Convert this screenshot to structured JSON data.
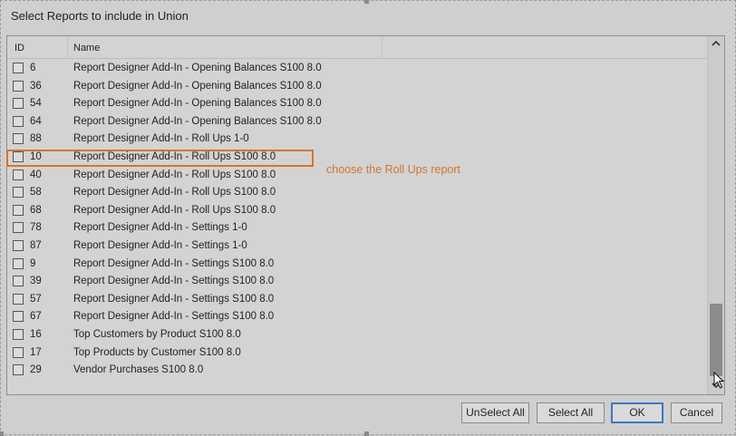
{
  "dialog": {
    "title": "Select Reports to include in Union"
  },
  "list": {
    "columns": {
      "id": "ID",
      "name": "Name"
    },
    "rows": [
      {
        "id": "6",
        "name": "Report Designer Add-In - Opening Balances S100 8.0"
      },
      {
        "id": "36",
        "name": "Report Designer Add-In - Opening Balances S100 8.0"
      },
      {
        "id": "54",
        "name": "Report Designer Add-In - Opening Balances S100 8.0"
      },
      {
        "id": "64",
        "name": "Report Designer Add-In - Opening Balances S100 8.0"
      },
      {
        "id": "88",
        "name": "Report Designer Add-In - Roll Ups 1-0"
      },
      {
        "id": "10",
        "name": "Report Designer Add-In - Roll Ups S100 8.0"
      },
      {
        "id": "40",
        "name": "Report Designer Add-In - Roll Ups S100 8.0"
      },
      {
        "id": "58",
        "name": "Report Designer Add-In - Roll Ups S100 8.0"
      },
      {
        "id": "68",
        "name": "Report Designer Add-In - Roll Ups S100 8.0"
      },
      {
        "id": "78",
        "name": "Report Designer Add-In - Settings 1-0"
      },
      {
        "id": "87",
        "name": "Report Designer Add-In - Settings 1-0"
      },
      {
        "id": "9",
        "name": "Report Designer Add-In - Settings S100 8.0"
      },
      {
        "id": "39",
        "name": "Report Designer Add-In - Settings S100 8.0"
      },
      {
        "id": "57",
        "name": "Report Designer Add-In - Settings S100 8.0"
      },
      {
        "id": "67",
        "name": "Report Designer Add-In - Settings S100 8.0"
      },
      {
        "id": "16",
        "name": "Top Customers by Product S100 8.0"
      },
      {
        "id": "17",
        "name": "Top Products by Customer S100 8.0"
      },
      {
        "id": "29",
        "name": "Vendor Purchases S100 8.0"
      }
    ]
  },
  "annotation": {
    "text": "choose the Roll Ups report",
    "color": "#d2762e"
  },
  "buttons": {
    "unselect_all": "UnSelect All",
    "select_all": "Select All",
    "ok": "OK",
    "cancel": "Cancel"
  },
  "icons": {
    "scroll_up": "chevron-up-icon",
    "scroll_down": "chevron-down-icon",
    "cursor": "mouse-pointer-icon"
  }
}
